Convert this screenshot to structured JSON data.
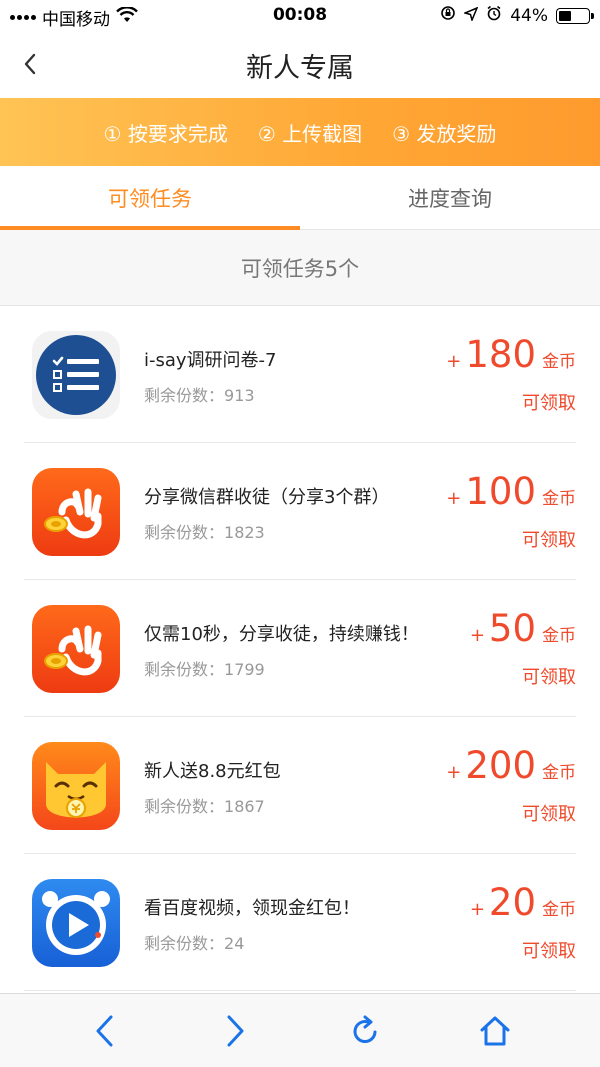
{
  "status_bar": {
    "carrier": "中国移动",
    "time": "00:08",
    "battery": "44%",
    "battery_level": 0.44
  },
  "nav": {
    "title": "新人专属"
  },
  "steps": [
    "① 按要求完成",
    "② 上传截图",
    "③ 发放奖励"
  ],
  "tabs": [
    {
      "label": "可领任务",
      "active": true
    },
    {
      "label": "进度查询",
      "active": false
    }
  ],
  "task_count_label": "可领任务5个",
  "tasks": [
    {
      "title": "i-say调研问卷-7",
      "remain_label": "剩余份数：",
      "remain": "913",
      "plus": "+",
      "amount": "180",
      "unit": "金币",
      "status": "可领取",
      "icon": "survey-list-icon"
    },
    {
      "title": "分享微信群收徒（分享3个群）",
      "remain_label": "剩余份数：",
      "remain": "1823",
      "plus": "+",
      "amount": "100",
      "unit": "金币",
      "status": "可领取",
      "icon": "ok-hand-coin-icon"
    },
    {
      "title": "仅需10秒，分享收徒，持续赚钱！",
      "remain_label": "剩余份数：",
      "remain": "1799",
      "plus": "+",
      "amount": "50",
      "unit": "金币",
      "status": "可领取",
      "icon": "ok-hand-coin-icon"
    },
    {
      "title": "新人送8.8元红包",
      "remain_label": "剩余份数：",
      "remain": "1867",
      "plus": "+",
      "amount": "200",
      "unit": "金币",
      "status": "可领取",
      "icon": "cat-coin-icon"
    },
    {
      "title": "看百度视频，领现金红包！",
      "remain_label": "剩余份数：",
      "remain": "24",
      "plus": "+",
      "amount": "20",
      "unit": "金币",
      "status": "可领取",
      "icon": "video-play-icon"
    }
  ],
  "colors": {
    "accent": "#ff8c22",
    "reward": "#f04a2c",
    "banner_start": "#ffc455",
    "banner_end": "#ff9b2e",
    "toolbar_icon": "#1a73e8"
  },
  "bottom_bar": {
    "icons": [
      "back-icon",
      "forward-icon",
      "refresh-icon",
      "home-icon"
    ]
  }
}
